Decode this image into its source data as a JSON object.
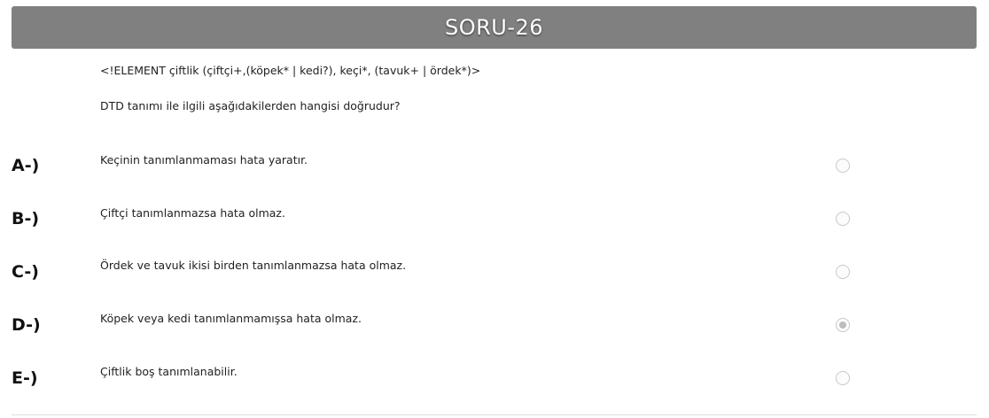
{
  "header": {
    "title": "SORU-26"
  },
  "question": {
    "code": "<!ELEMENT çiftlik (çiftçi+,(köpek* | kedi?), keçi*, (tavuk+ | ördek*)>",
    "text": "DTD tanımı ile ilgili aşağıdakilerden hangisi doğrudur?"
  },
  "options": [
    {
      "letter": "A-)",
      "text": "Keçinin tanımlanmaması hata yaratır.",
      "selected": false
    },
    {
      "letter": "B-)",
      "text": "Çiftçi tanımlanmazsa hata olmaz.",
      "selected": false
    },
    {
      "letter": "C-)",
      "text": "Ördek ve tavuk ikisi birden tanımlanmazsa hata olmaz.",
      "selected": false
    },
    {
      "letter": "D-)",
      "text": "Köpek veya kedi tanımlanmamışsa hata olmaz.",
      "selected": true
    },
    {
      "letter": "E-)",
      "text": "Çiftlik boş tanımlanabilir.",
      "selected": false
    }
  ]
}
